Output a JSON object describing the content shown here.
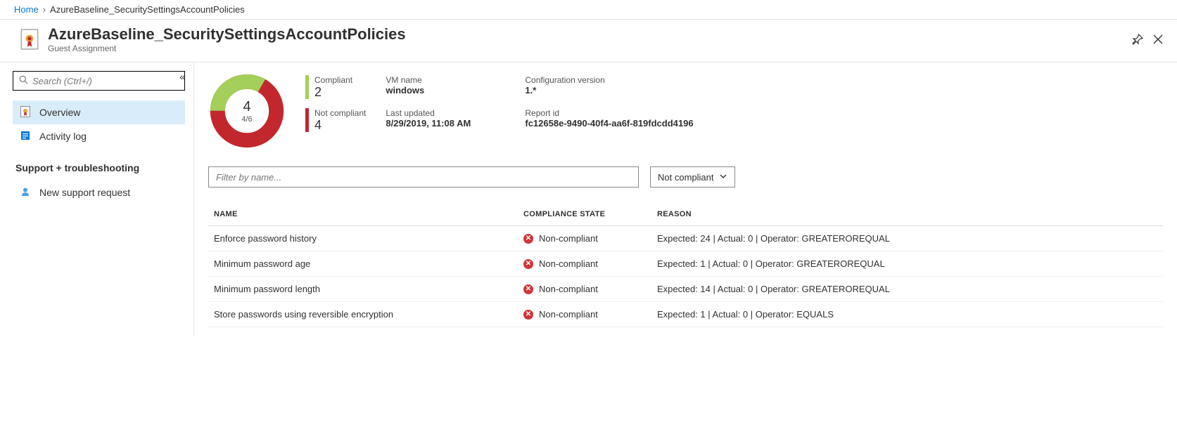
{
  "breadcrumb": {
    "home": "Home",
    "current": "AzureBaseline_SecuritySettingsAccountPolicies"
  },
  "header": {
    "title": "AzureBaseline_SecuritySettingsAccountPolicies",
    "subtitle": "Guest Assignment"
  },
  "sidebar": {
    "search_placeholder": "Search (Ctrl+/)",
    "items": {
      "overview": "Overview",
      "activity_log": "Activity log"
    },
    "section_title": "Support + troubleshooting",
    "support_items": {
      "new_support": "New support request"
    }
  },
  "donut": {
    "big": "4",
    "small": "4/6"
  },
  "stats": {
    "compliant_label": "Compliant",
    "compliant_value": "2",
    "noncompliant_label": "Not compliant",
    "noncompliant_value": "4"
  },
  "info": {
    "vm_name_label": "VM name",
    "vm_name_value": "windows",
    "last_updated_label": "Last updated",
    "last_updated_value": "8/29/2019, 11:08 AM",
    "config_version_label": "Configuration version",
    "config_version_value": "1.*",
    "report_id_label": "Report id",
    "report_id_value": "fc12658e-9490-40f4-aa6f-819fdcdd4196"
  },
  "filter": {
    "placeholder": "Filter by name...",
    "dropdown_value": "Not compliant"
  },
  "table": {
    "headers": {
      "name": "NAME",
      "state": "COMPLIANCE STATE",
      "reason": "REASON"
    },
    "rows": [
      {
        "name": "Enforce password history",
        "state": "Non-compliant",
        "reason": "Expected: 24 | Actual: 0 | Operator: GREATEROREQUAL"
      },
      {
        "name": "Minimum password age",
        "state": "Non-compliant",
        "reason": "Expected: 1 | Actual: 0 | Operator: GREATEROREQUAL"
      },
      {
        "name": "Minimum password length",
        "state": "Non-compliant",
        "reason": "Expected: 14 | Actual: 0 | Operator: GREATEROREQUAL"
      },
      {
        "name": "Store passwords using reversible encryption",
        "state": "Non-compliant",
        "reason": "Expected: 1 | Actual: 0 | Operator: EQUALS"
      }
    ]
  },
  "chart_data": {
    "type": "pie",
    "title": "Compliance",
    "categories": [
      "Compliant",
      "Not compliant"
    ],
    "values": [
      2,
      4
    ],
    "colors": [
      "#a4cf5a",
      "#c1272d"
    ],
    "center_value": 4,
    "center_fraction": "4/6"
  }
}
